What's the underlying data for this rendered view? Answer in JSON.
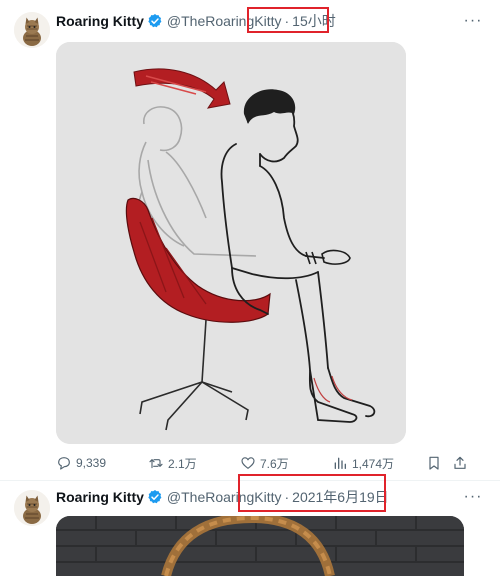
{
  "tweets": [
    {
      "author_name": "Roaring Kitty",
      "handle": "@TheRoaringKitty",
      "separator": "·",
      "time": "15小时",
      "more": "···",
      "actions": {
        "replies": "9,339",
        "retweets": "2.1万",
        "likes": "7.6万",
        "views": "1,474万"
      }
    },
    {
      "author_name": "Roaring Kitty",
      "handle": "@TheRoaringKitty",
      "separator": "·",
      "time": "2021年6月19日",
      "more": "···"
    }
  ],
  "colors": {
    "verified": "#1d9bf0",
    "highlight_box": "#e0232b",
    "muted_text": "#536471",
    "chair_red": "#b31e22"
  },
  "icons": {
    "verified": "verified-badge-icon",
    "reply": "reply-icon",
    "retweet": "retweet-icon",
    "like": "heart-icon",
    "views": "views-bar-chart-icon",
    "bookmark": "bookmark-icon",
    "share": "share-icon",
    "more": "more-dots-icon"
  }
}
